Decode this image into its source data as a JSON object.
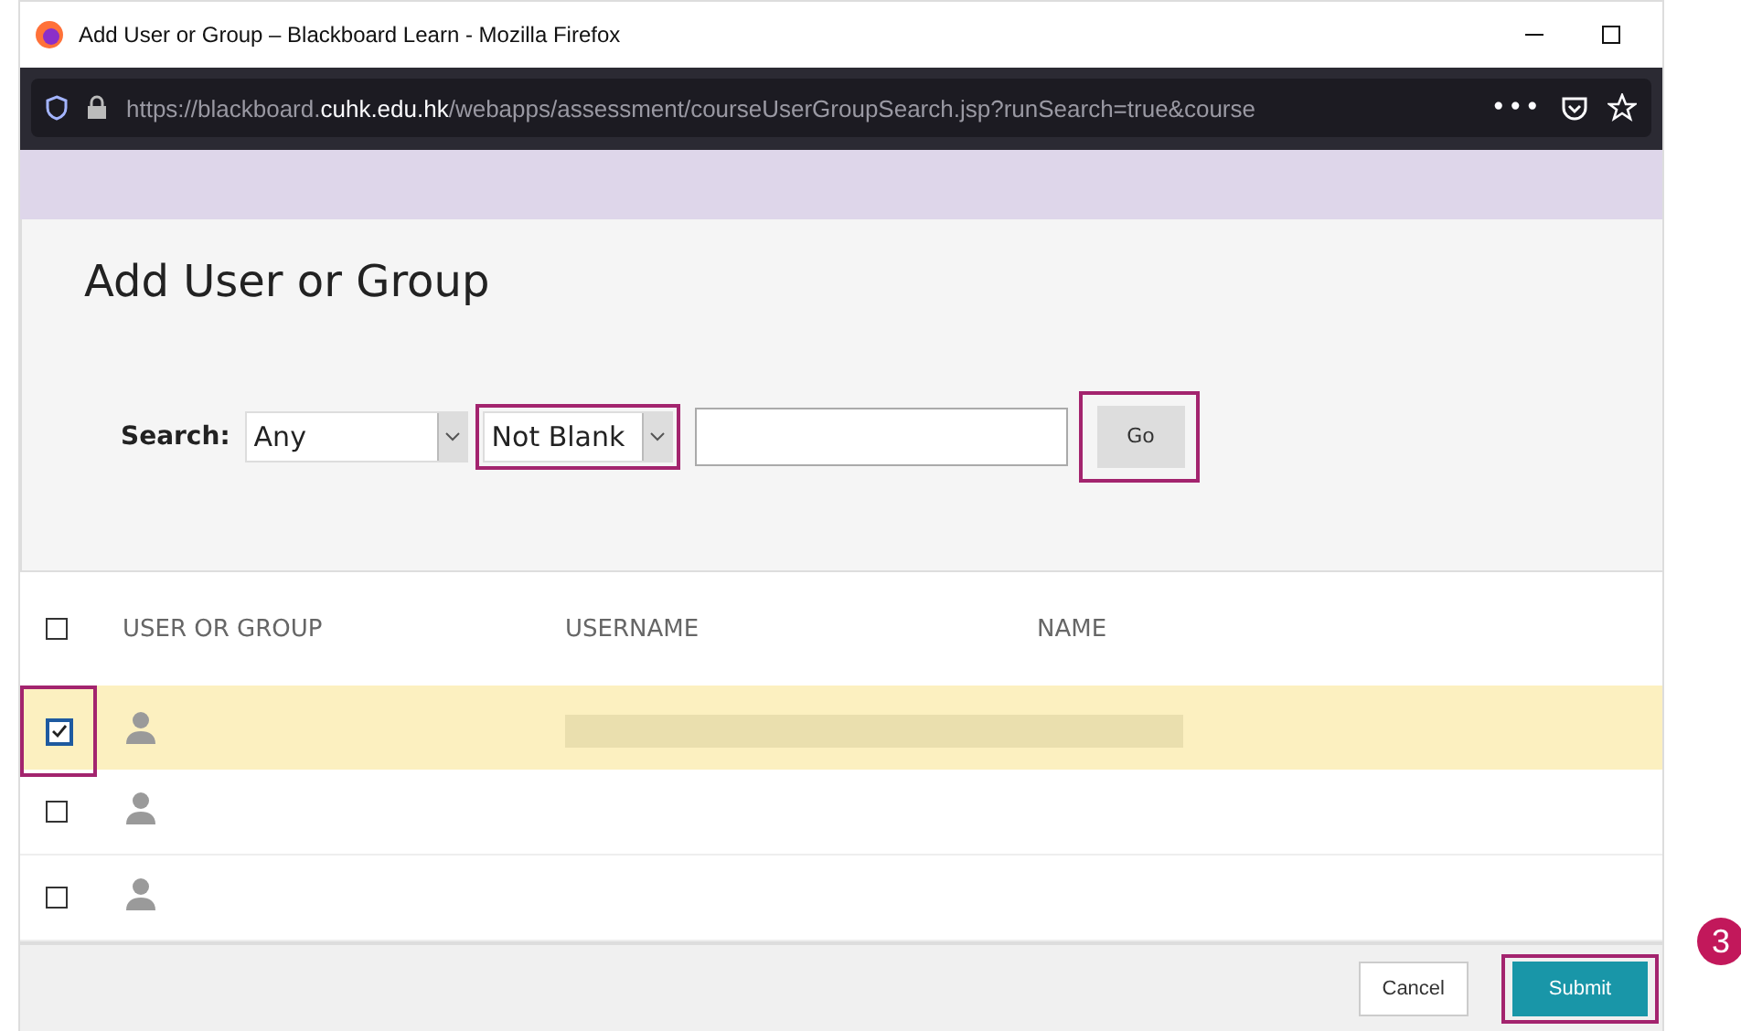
{
  "window": {
    "title": "Add User or Group – Blackboard Learn - Mozilla Firefox"
  },
  "address_bar": {
    "url": "https://blackboard.**cuhk.edu.hk**/webapps/assessment/courseUserGroupSearch.jsp?runSearch=true&course",
    "menu": "•••"
  },
  "page": {
    "heading": "Add User or Group"
  },
  "search": {
    "label": "Search:",
    "field": "Any",
    "operator": "Not Blank",
    "operator_highlighted": true,
    "go": "Go",
    "go_highlighted": true
  },
  "table": {
    "select_all": {
      "checked": false
    },
    "columns": [
      "USER OR GROUP",
      "USERNAME",
      "NAME"
    ],
    "rows": [
      {
        "checked": true,
        "highlighted": true,
        "redacted": true
      },
      {
        "checked": false,
        "highlighted": false,
        "redacted": false
      },
      {
        "checked": false,
        "highlighted": false,
        "redacted": false
      }
    ]
  },
  "buttons": [
    {
      "label": "Cancel",
      "kind": "secondary",
      "highlighted": false
    },
    {
      "label": "Submit",
      "kind": "primary",
      "highlighted": true
    }
  ],
  "step_badge": "3"
}
